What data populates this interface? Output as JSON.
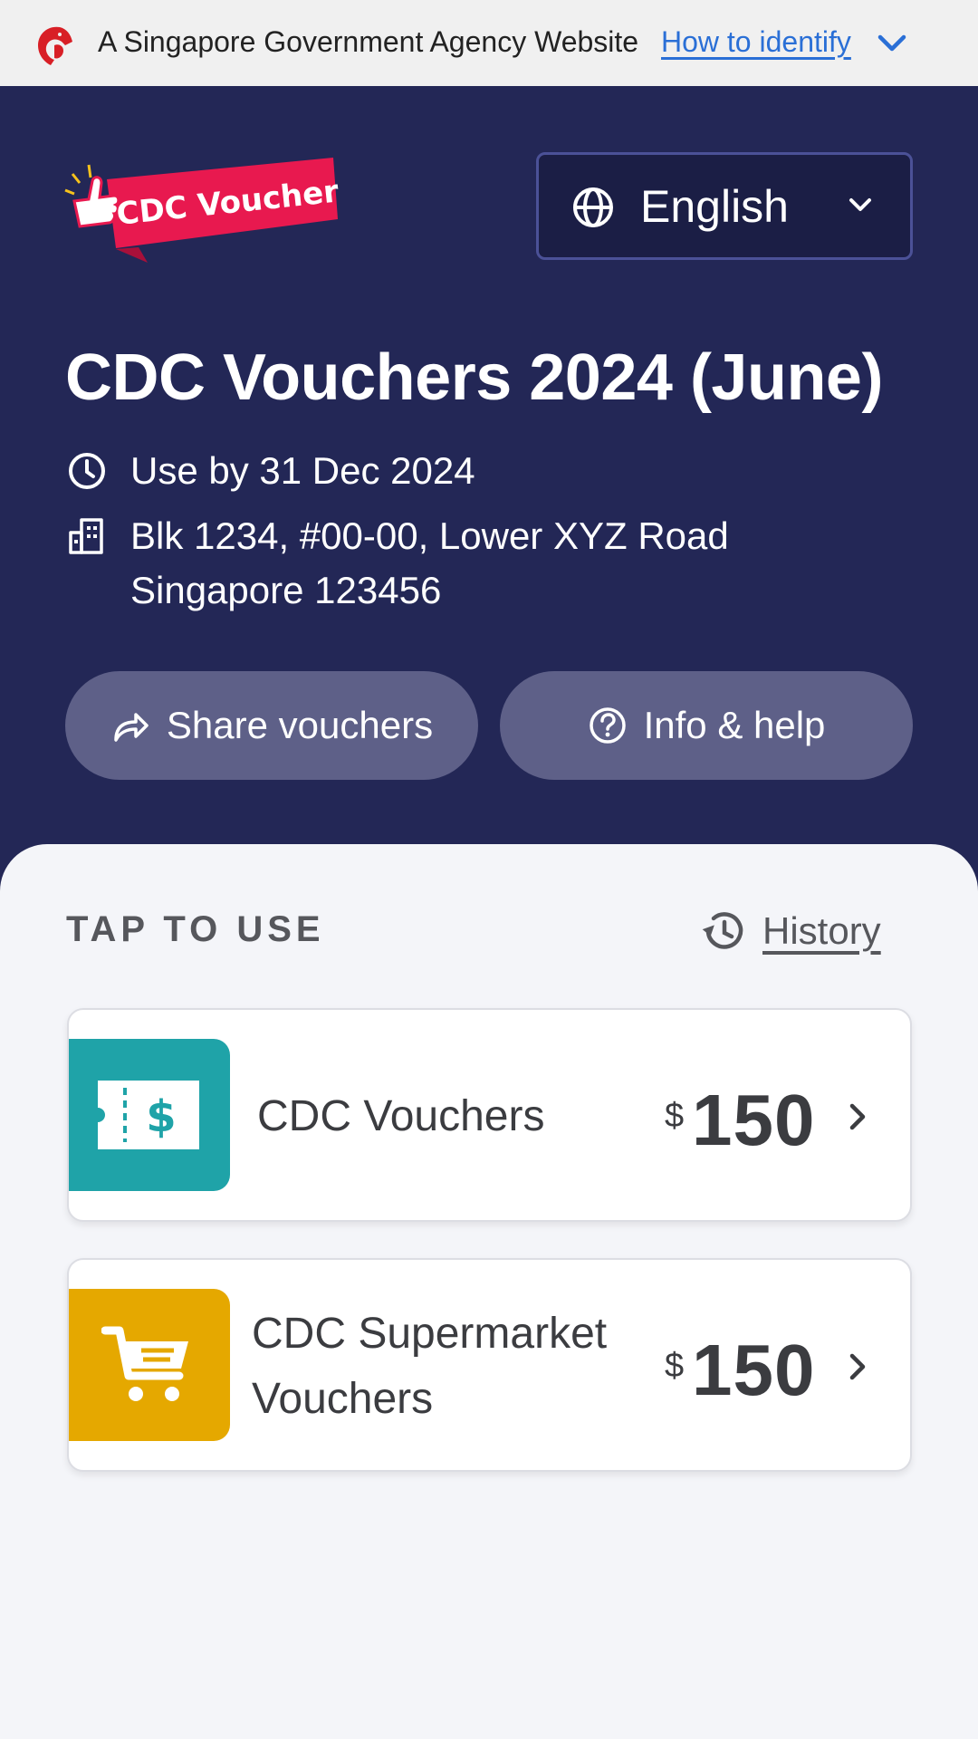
{
  "masthead": {
    "text": "A Singapore Government Agency Website",
    "link": "How to identify"
  },
  "header": {
    "logo_text": "CDC Voucher",
    "language": "English"
  },
  "hero": {
    "title": "CDC Vouchers 2024 (June)",
    "use_by": "Use by 31 Dec 2024",
    "address_line1": "Blk 1234, #00-00, Lower XYZ Road",
    "address_line2": "Singapore 123456",
    "share_label": "Share vouchers",
    "help_label": "Info & help"
  },
  "content": {
    "section_label": "TAP TO USE",
    "history_label": "History",
    "vouchers": [
      {
        "name": "CDC Vouchers",
        "currency": "$",
        "amount": "150",
        "color": "#1fa3a8"
      },
      {
        "name_line1": "CDC Supermarket",
        "name_line2": "Vouchers",
        "currency": "$",
        "amount": "150",
        "color": "#e5a800"
      }
    ]
  },
  "colors": {
    "hero_bg": "#232756",
    "pill_bg": "#5e6088",
    "logo_red": "#e8194f",
    "link_blue": "#2a6fd6"
  }
}
